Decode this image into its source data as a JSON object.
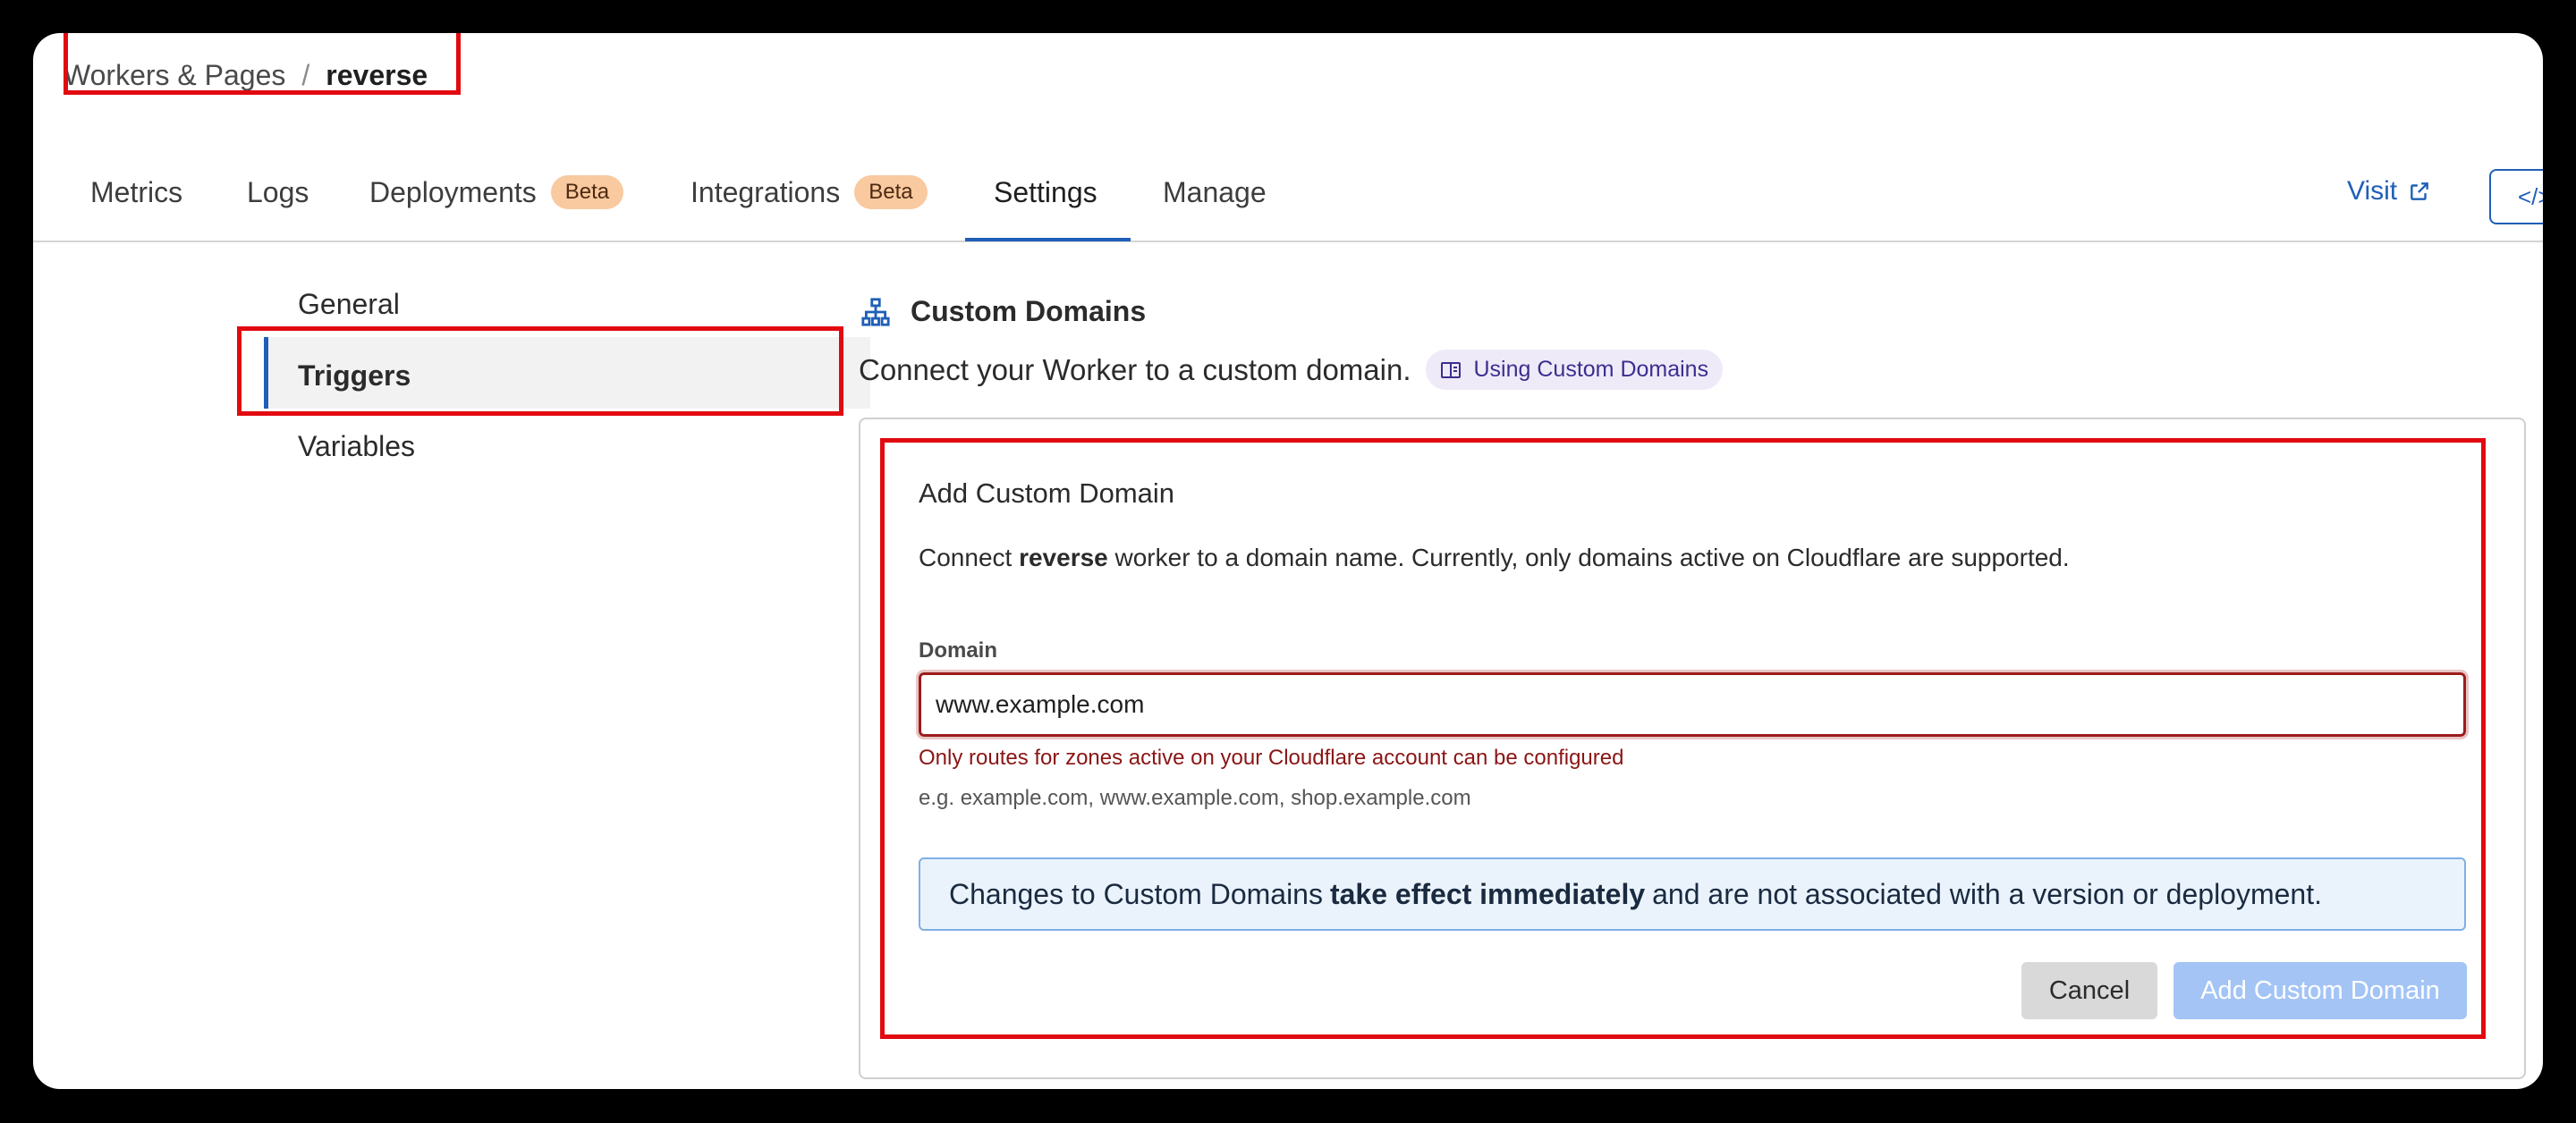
{
  "breadcrumb": {
    "parent": "Workers & Pages",
    "separator": "/",
    "current": "reverse"
  },
  "tabs": [
    {
      "label": "Metrics"
    },
    {
      "label": "Logs"
    },
    {
      "label": "Deployments",
      "badge": "Beta"
    },
    {
      "label": "Integrations",
      "badge": "Beta"
    },
    {
      "label": "Settings",
      "active": true
    },
    {
      "label": "Manage"
    }
  ],
  "header_actions": {
    "visit_label": "Visit",
    "visit_icon": "external-link-icon",
    "code_icon": "code-icon",
    "code_label": "</>"
  },
  "settings_nav": [
    {
      "label": "General"
    },
    {
      "label": "Triggers",
      "active": true
    },
    {
      "label": "Variables"
    }
  ],
  "custom_domains": {
    "icon": "sitemap-icon",
    "title": "Custom Domains",
    "description": "Connect your Worker to a custom domain.",
    "doc_link": "Using Custom Domains",
    "doc_icon": "book-icon"
  },
  "add_form": {
    "title": "Add Custom Domain",
    "desc_prefix": "Connect",
    "desc_worker": "reverse",
    "desc_suffix": "worker to a domain name. Currently, only domains active on Cloudflare are supported.",
    "field_label": "Domain",
    "field_value": "www.example.com",
    "error": "Only routes for zones active on your Cloudflare account can be configured",
    "hint": "e.g. example.com, www.example.com, shop.example.com",
    "info_prefix": "Changes to Custom Domains",
    "info_bold": "take effect immediately",
    "info_suffix": "and are not associated with a version or deployment.",
    "cancel_label": "Cancel",
    "submit_label": "Add Custom Domain"
  },
  "colors": {
    "accent": "#1f5fb8",
    "annotation": "#e10a10",
    "error": "#8a1515",
    "badge": "#f9c9a0"
  }
}
